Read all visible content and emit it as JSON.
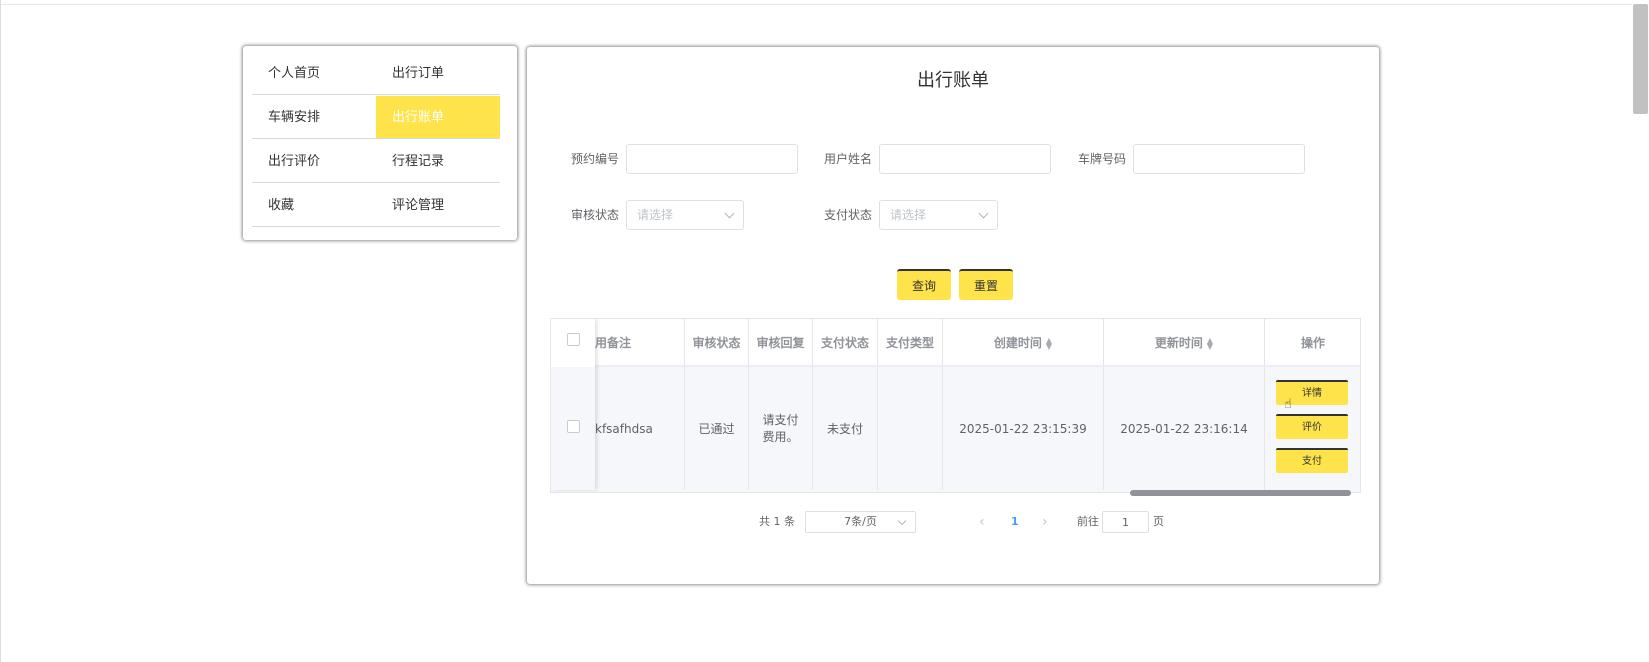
{
  "sidebar": {
    "items": [
      {
        "label": "个人首页",
        "active": false
      },
      {
        "label": "出行订单",
        "active": false
      },
      {
        "label": "车辆安排",
        "active": false
      },
      {
        "label": "出行账单",
        "active": true
      },
      {
        "label": "出行评价",
        "active": false
      },
      {
        "label": "行程记录",
        "active": false
      },
      {
        "label": "收藏",
        "active": false
      },
      {
        "label": "评论管理",
        "active": false
      }
    ]
  },
  "main": {
    "title": "出行账单",
    "filters": {
      "booking_no_label": "预约编号",
      "user_name_label": "用户姓名",
      "plate_no_label": "车牌号码",
      "review_status_label": "审核状态",
      "review_status_placeholder": "请选择",
      "pay_status_label": "支付状态",
      "pay_status_placeholder": "请选择"
    },
    "buttons": {
      "search": "查询",
      "reset": "重置"
    },
    "table": {
      "columns": [
        "用备注",
        "审核状态",
        "审核回复",
        "支付状态",
        "支付类型",
        "创建时间",
        "更新时间",
        "操作"
      ],
      "rows": [
        {
          "remark": "kfsafhdsa",
          "review_status": "已通过",
          "review_reply": "请支付费用。",
          "pay_status": "未支付",
          "pay_type": "",
          "created": "2025-01-22 23:15:39",
          "updated": "2025-01-22 23:16:14",
          "actions": [
            "详情",
            "评价",
            "支付"
          ]
        }
      ]
    },
    "pagination": {
      "total": "共 1 条",
      "page_size": "7条/页",
      "current_page": "1",
      "goto_label": "前往",
      "goto_value": "1",
      "page_unit": "页"
    }
  },
  "colors": {
    "accent": "#ffe34a",
    "link": "#409eff"
  }
}
